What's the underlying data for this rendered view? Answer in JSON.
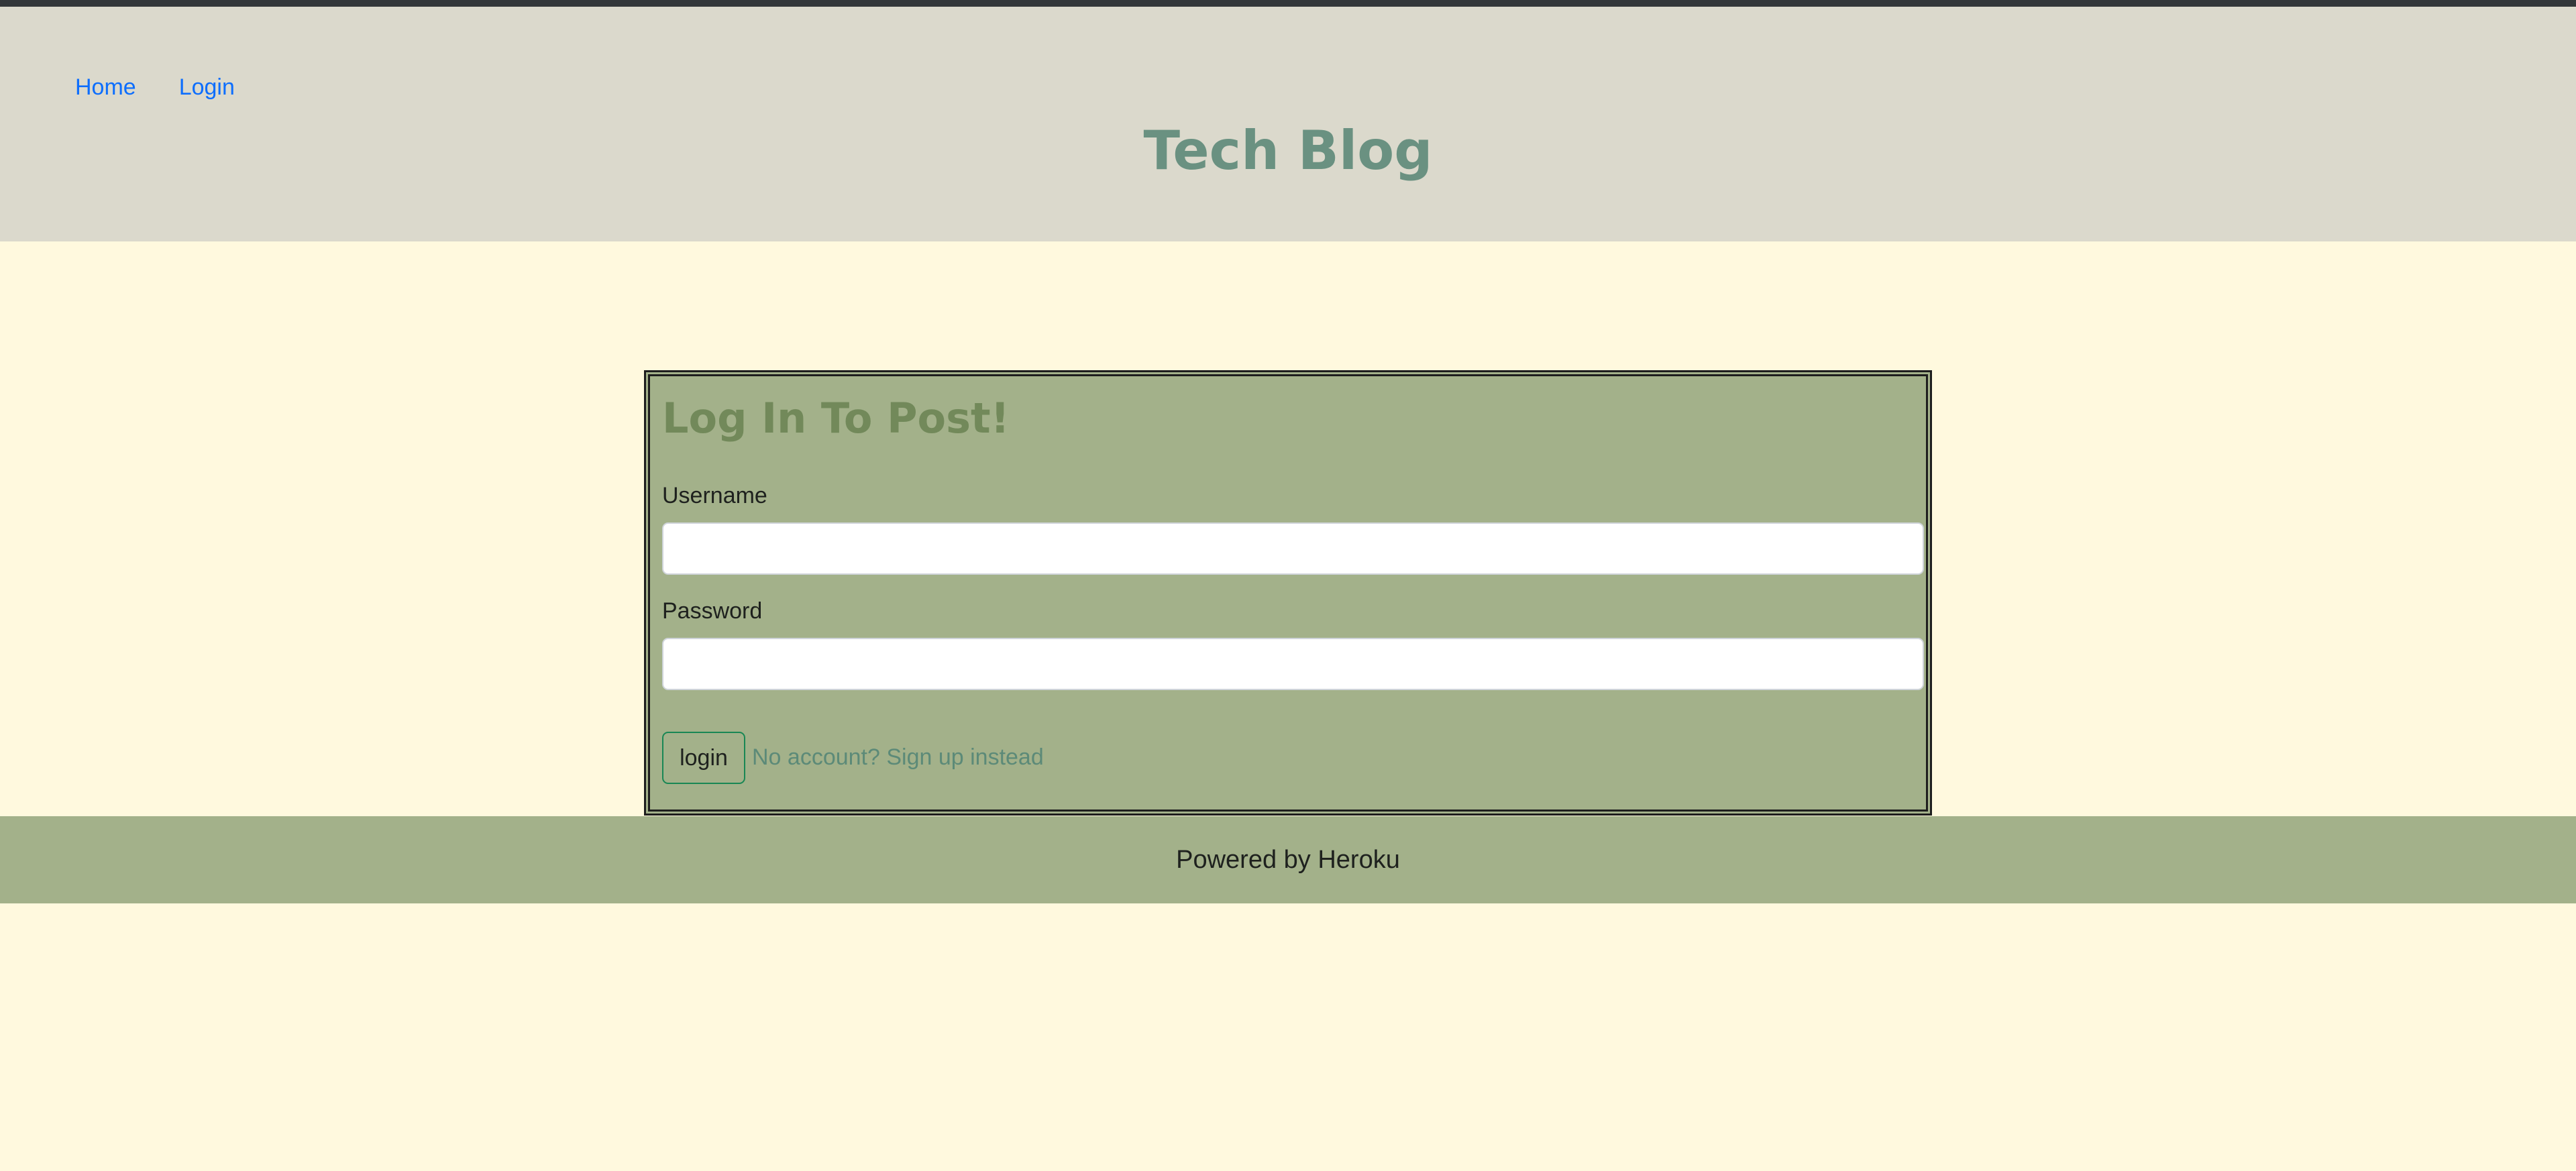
{
  "nav": {
    "home_label": "Home",
    "login_label": "Login"
  },
  "header": {
    "title": "Tech Blog"
  },
  "login_form": {
    "title": "Log In To Post!",
    "username_label": "Username",
    "username_value": "",
    "password_label": "Password",
    "password_value": "",
    "submit_label": "login",
    "signup_link_text": "No account? Sign up instead"
  },
  "footer": {
    "text": "Powered by Heroku"
  },
  "colors": {
    "page_background": "#fff9de",
    "header_background": "#dbd9cc",
    "card_background": "#a3b18a",
    "title_color": "#6a9181",
    "card_title_color": "#72895a",
    "link_color": "#0d6efd",
    "button_border": "#198754"
  }
}
